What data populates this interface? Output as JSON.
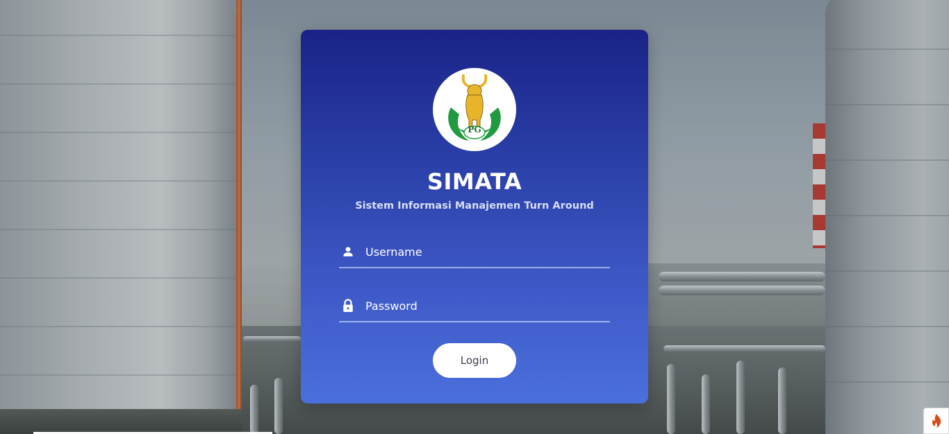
{
  "app": {
    "title": "SIMATA",
    "subtitle": "Sistem Informasi Manajemen Turn Around"
  },
  "logo": {
    "text": "PG",
    "icon": "petrokimia-bull-logo"
  },
  "form": {
    "username": {
      "placeholder": "Username",
      "value": "",
      "icon": "user-icon"
    },
    "password": {
      "placeholder": "Password",
      "value": "",
      "icon": "lock-icon"
    },
    "login_label": "Login"
  },
  "colors": {
    "card_top": "#1a2387",
    "card_bottom": "#4a6fdc",
    "accent_white": "#ffffff",
    "logo_gold": "#e8b52a",
    "logo_green": "#1f9a3e"
  },
  "badge": {
    "icon": "codeigniter-flame-icon"
  }
}
